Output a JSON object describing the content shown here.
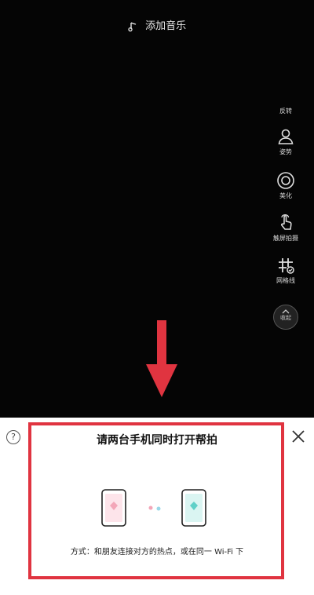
{
  "camera": {
    "music_label": "添加音乐",
    "music_icon": "music-note-icon"
  },
  "side_tools": [
    {
      "label": "反转",
      "icon": "flip-camera-icon"
    },
    {
      "label": "姿势",
      "icon": "pose-person-icon"
    },
    {
      "label": "美化",
      "icon": "beauty-ring-icon"
    },
    {
      "label": "触屏拍摄",
      "icon": "tap-to-shoot-icon"
    },
    {
      "label": "网格线",
      "icon": "grid-lines-icon"
    },
    {
      "label": "收起",
      "icon": "chevron-up-icon"
    }
  ],
  "overlay": {
    "arrow_color": "#e03440",
    "arrow_icon": "down-arrow-icon"
  },
  "panel": {
    "help_icon_text": "?",
    "title": "请两台手机同时打开帮拍",
    "method_text": "方式：和朋友连接对方的热点，或在同一 Wi-Fi 下",
    "left_phone_color": "#f3a6b8",
    "right_phone_color": "#5fd0c8",
    "highlight_color": "#e03440"
  }
}
